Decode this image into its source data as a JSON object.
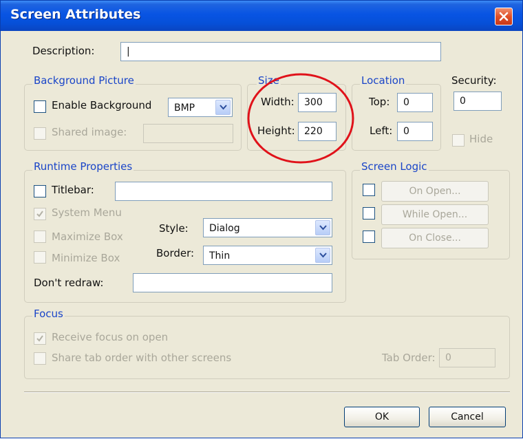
{
  "window": {
    "title": "Screen Attributes"
  },
  "description": {
    "label": "Description:",
    "value": "|"
  },
  "background_picture": {
    "group_label": "Background Picture",
    "enable_label": "Enable Background",
    "format_value": "BMP",
    "shared_label": "Shared image:",
    "shared_value": ""
  },
  "size": {
    "group_label": "Size",
    "width_label": "Width:",
    "width_value": "300",
    "height_label": "Height:",
    "height_value": "220"
  },
  "location": {
    "group_label": "Location",
    "top_label": "Top:",
    "top_value": "0",
    "left_label": "Left:",
    "left_value": "0"
  },
  "security": {
    "label": "Security:",
    "value": "0",
    "hide_label": "Hide"
  },
  "runtime": {
    "group_label": "Runtime Properties",
    "titlebar_label": "Titlebar:",
    "titlebar_value": "",
    "system_menu_label": "System Menu",
    "maximize_label": "Maximize Box",
    "minimize_label": "Minimize Box",
    "style_label": "Style:",
    "style_value": "Dialog",
    "border_label": "Border:",
    "border_value": "Thin",
    "dont_redraw_label": "Don't redraw:",
    "dont_redraw_value": ""
  },
  "screen_logic": {
    "group_label": "Screen Logic",
    "on_open": "On Open...",
    "while_open": "While Open...",
    "on_close": "On Close..."
  },
  "focus": {
    "group_label": "Focus",
    "receive_label": "Receive focus on open",
    "share_label": "Share tab order with other screens",
    "tab_order_label": "Tab Order:",
    "tab_order_value": "0"
  },
  "buttons": {
    "ok": "OK",
    "cancel": "Cancel"
  },
  "colors": {
    "title_bar": "#0854e3",
    "group_title": "#1a45c8",
    "annotation_circle": "#e0121a",
    "dialog_bg": "#ece9d8"
  }
}
